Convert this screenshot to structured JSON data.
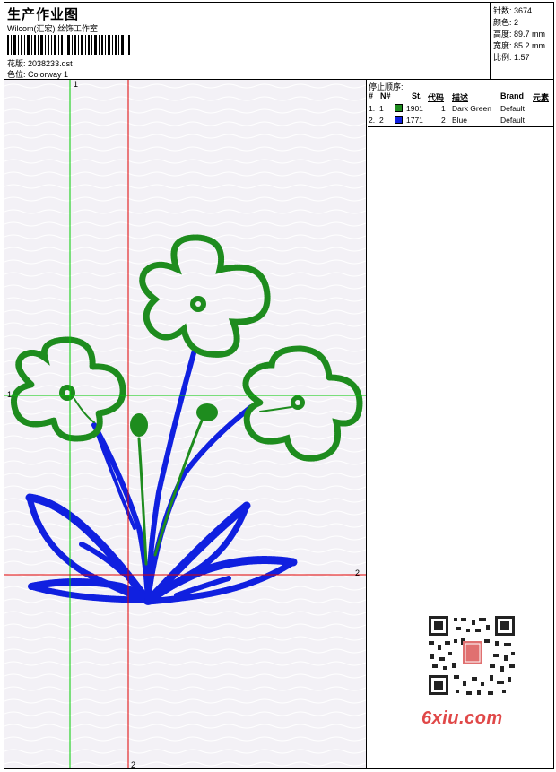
{
  "header": {
    "title": "生产作业图",
    "company": "Wilcom(汇宏) 丝饰工作室",
    "design_label": "花版:",
    "design_file": "2038233.dst",
    "colorway_label": "色位:",
    "colorway": "Colorway 1"
  },
  "stats": {
    "stitches_label": "针数:",
    "stitches": "3674",
    "colors_label": "颜色:",
    "colors": "2",
    "height_label": "高度:",
    "height": "89.7 mm",
    "width_label": "宽度:",
    "width": "85.2 mm",
    "ratio_label": "比例:",
    "ratio": "1.57"
  },
  "stop_sequence": {
    "title": "停止顺序:",
    "columns": [
      "#",
      "N#",
      "St.",
      "代码",
      "描述",
      "Brand",
      "元素"
    ],
    "rows": [
      {
        "index": "1.",
        "needle": "1",
        "color": "#1e8c1e",
        "stitches": "1901",
        "code": "1",
        "description": "Dark Green",
        "brand": "Default"
      },
      {
        "index": "2.",
        "needle": "2",
        "color": "#1020e0",
        "stitches": "1771",
        "code": "2",
        "description": "Blue",
        "brand": "Default"
      }
    ]
  },
  "crosshair_labels": {
    "green_top": "1",
    "green_left": "1",
    "red_right": "2",
    "red_bottom": "2"
  },
  "colors": {
    "green": "#1e8c1e",
    "blue": "#1020e0",
    "crosshair_green": "#00cc00",
    "crosshair_red": "#e00000",
    "canvas": "#f3f1f6"
  },
  "watermark": "6xiu.com"
}
